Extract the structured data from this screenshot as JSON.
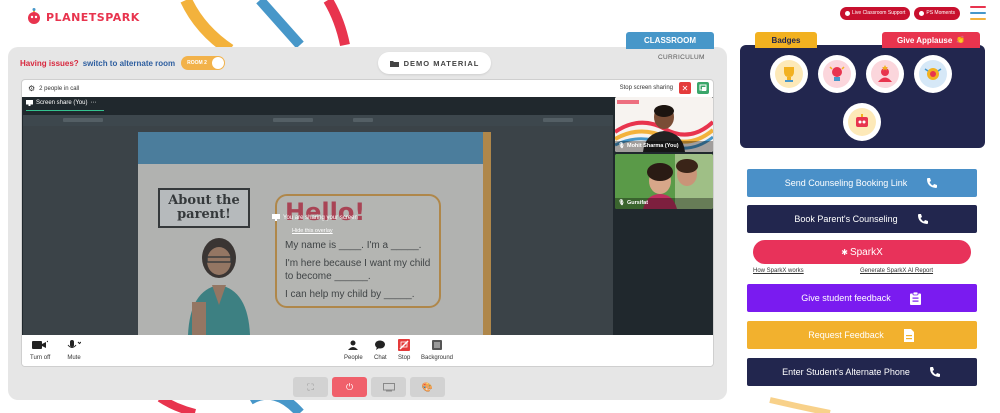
{
  "brand": {
    "name": "PLANETSPARK"
  },
  "topbar": {
    "live_support": "Live Classroom Support",
    "ps_moments": "PS Moments"
  },
  "issues": {
    "prefix": "Having issues?",
    "link": "switch to alternate room",
    "room_label": "ROOM 2"
  },
  "demo_material": "DEMO MATERIAL",
  "call": {
    "people_count": "2 people in call",
    "stop_sharing": "Stop screen sharing",
    "screen_share_tab": "Screen share (You)",
    "sharing_message": "You are sharing your screen",
    "hide_overlay": "Hide this overlay"
  },
  "slide": {
    "title": "About the parent!",
    "hello": "Hello!",
    "line1": "My name is ____. I'm a _____.",
    "line2": "I'm here because I want my child to become ______.",
    "line3": "I can help my child by _____."
  },
  "participants": [
    {
      "name": "Mohit Sharma (You)"
    },
    {
      "name": "Gursifat"
    }
  ],
  "controls": {
    "turn_off": "Turn off",
    "mute": "Mute",
    "people": "People",
    "chat": "Chat",
    "stop": "Stop",
    "background": "Background"
  },
  "tabs": {
    "classroom": "CLASSROOM",
    "curriculum": "CURRICULUM",
    "badges": "Badges",
    "applause": "Give Applause"
  },
  "actions": {
    "send_counseling": "Send Counseling Booking Link",
    "book_counseling": "Book Parent's Counseling",
    "sparkx": "SparkX",
    "how_sparkx": "How SparkX works",
    "generate_sparkx": "Generate SparkX AI Report",
    "student_feedback": "Give student feedback",
    "request_feedback": "Request Feedback",
    "alternate_phone": "Enter Student's Alternate Phone"
  },
  "colors": {
    "brand_red": "#e8344e",
    "brand_blue": "#4797c9",
    "navy": "#22264e",
    "purple": "#7a1bf0",
    "amber": "#f2b120",
    "sparkx_pink": "#e8325a"
  },
  "icons": [
    "gear-icon",
    "close-icon",
    "screen-share-icon",
    "camera-icon",
    "mic-icon",
    "people-icon",
    "chat-icon",
    "stop-share-icon",
    "background-icon",
    "fullscreen-icon",
    "power-icon",
    "screen-icon",
    "palette-icon",
    "phone-icon",
    "clipboard-icon",
    "document-icon",
    "clap-icon",
    "folder-icon"
  ]
}
